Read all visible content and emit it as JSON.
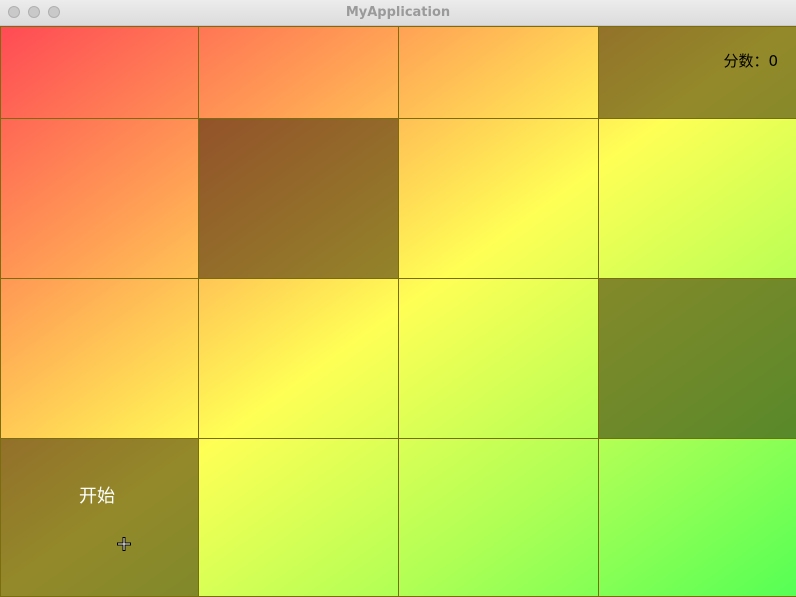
{
  "window": {
    "title": "MyApplication"
  },
  "game": {
    "score_label": "分数：0",
    "start_label": "开始",
    "rows": 4,
    "cols": 4,
    "dark_cells": [
      [
        0,
        3
      ],
      [
        1,
        1
      ],
      [
        2,
        3
      ],
      [
        3,
        0
      ]
    ],
    "colors": {
      "gradient_start": "#ff4a55",
      "gradient_mid": "#ffff55",
      "gradient_end": "#55ff55",
      "grid_line": "#7a6d10"
    }
  }
}
